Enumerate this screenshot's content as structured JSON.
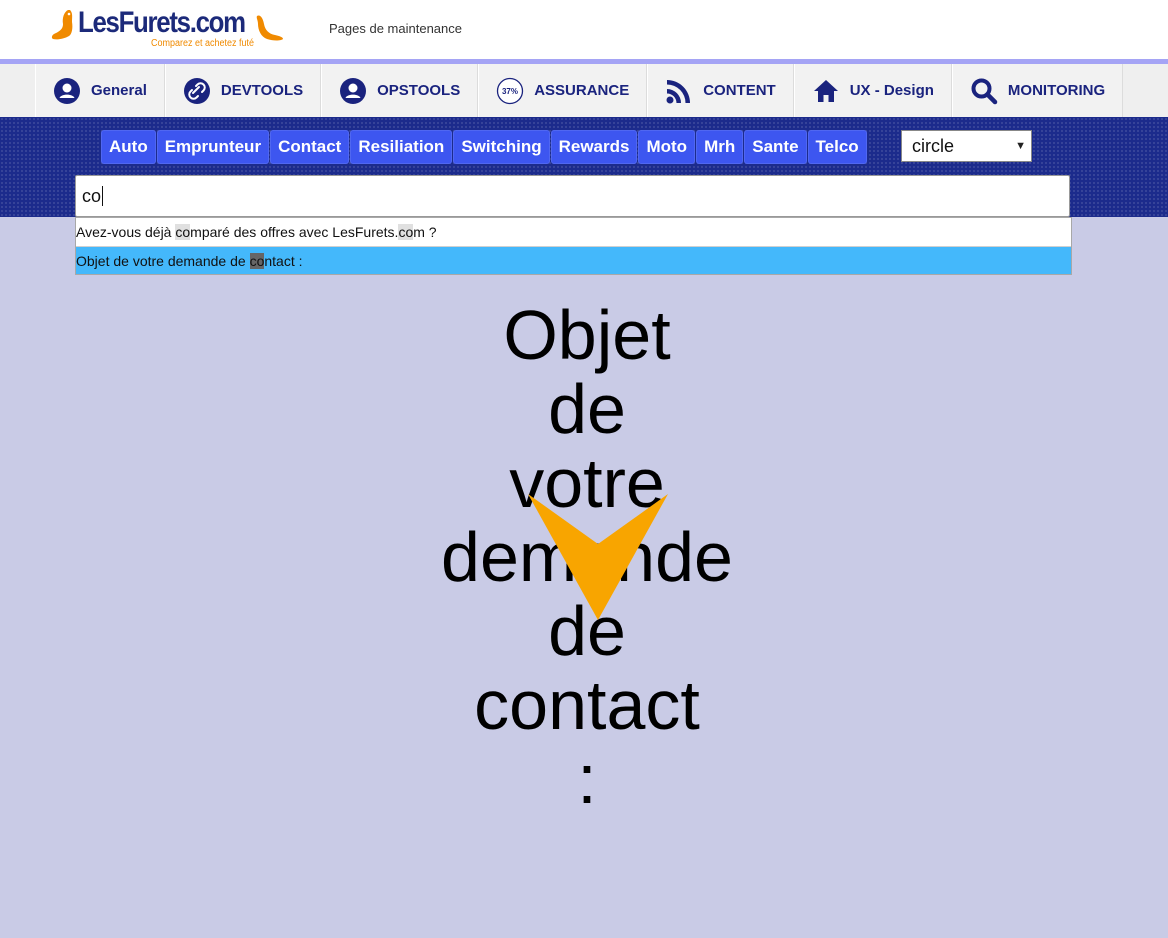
{
  "header": {
    "logo_text": "LesFurets.com",
    "logo_tagline": "Comparez et achetez futé",
    "page_subtitle": "Pages de maintenance"
  },
  "mainnav": {
    "items": [
      {
        "label": "General",
        "icon": "user-circle-icon"
      },
      {
        "label": "DEVTOOLS",
        "icon": "link-circle-icon"
      },
      {
        "label": "OPSTOOLS",
        "icon": "user-circle-icon"
      },
      {
        "label": "ASSURANCE",
        "icon": "percent-badge-icon",
        "icon_text": "37%"
      },
      {
        "label": "CONTENT",
        "icon": "rss-icon"
      },
      {
        "label": "UX - Design",
        "icon": "home-icon"
      },
      {
        "label": "MONITORING",
        "icon": "search-icon"
      }
    ]
  },
  "subtabs": [
    "Auto",
    "Emprunteur",
    "Contact",
    "Resiliation",
    "Switching",
    "Rewards",
    "Moto",
    "Mrh",
    "Sante",
    "Telco"
  ],
  "select": {
    "value": "circle"
  },
  "search": {
    "value": "co"
  },
  "suggestions": [
    {
      "pre": "Avez-vous déjà ",
      "match": "co",
      "mid": "mparé des offres avec LesFurets.",
      "match2": "co",
      "post": "m ?"
    },
    {
      "pre": "Objet de votre demande de ",
      "match": "co",
      "post": "ntact :"
    }
  ],
  "preview": {
    "words": [
      "Objet",
      "de",
      "votre",
      "demande",
      "de",
      "contact",
      ":"
    ]
  },
  "colors": {
    "brand_navy": "#1c2a7a",
    "brand_orange": "#f08a00",
    "accent_line": "#a5a4f5",
    "band": "#1c2b8c",
    "tab_blue": "#3d56f0",
    "highlight": "#44b8fb",
    "page_bg": "#c9cbe6"
  }
}
